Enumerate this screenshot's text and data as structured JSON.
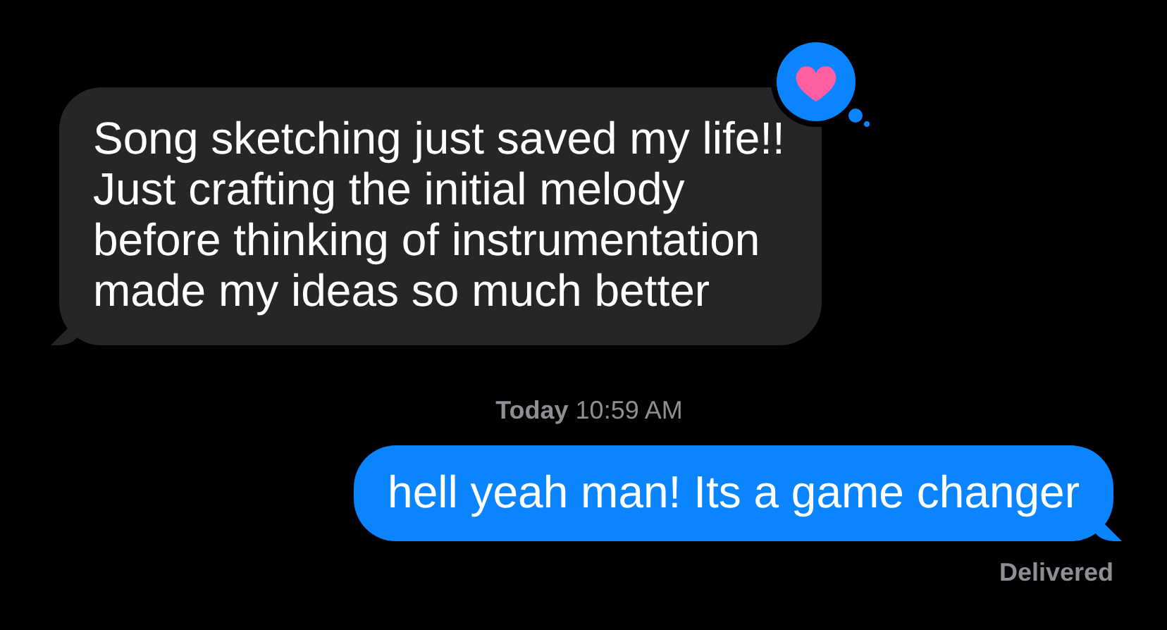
{
  "messages": [
    {
      "kind": "received",
      "text": "Song sketching just saved my life!!\nJust crafting the initial melody\nbefore thinking of instrumentation\nmade my ideas so much better",
      "tapback": true
    },
    {
      "kind": "timestamp",
      "text": "**Today** 10:59 AM"
    },
    {
      "kind": "sent",
      "text": "hell yeah man! Its a game changer",
      "tapback": false
    }
  ],
  "status": "Delivered"
}
